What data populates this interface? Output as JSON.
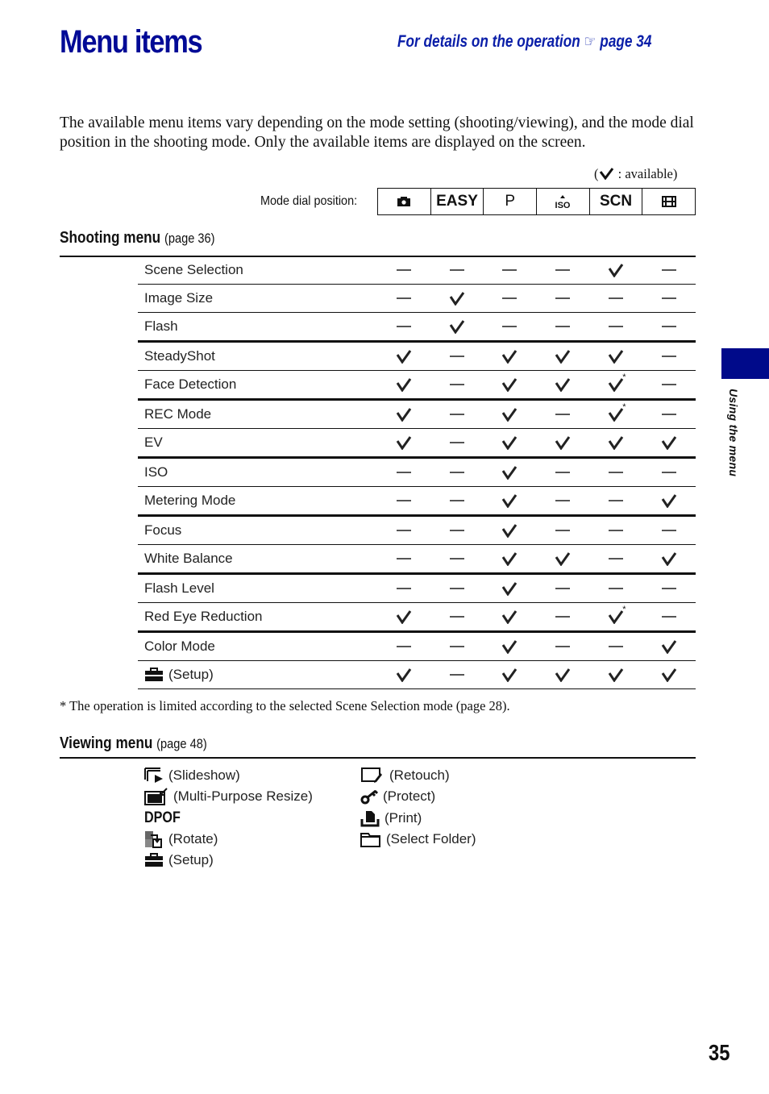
{
  "page": {
    "title": "Menu items",
    "xref_prefix": "For details on the operation",
    "xref_page": "page 34",
    "intro": "The available menu items vary depending on the mode setting (shooting/viewing), and the mode dial position in the shooting mode. Only the available items are displayed on the screen.",
    "legend_text": " : available)",
    "legend_open": "(",
    "page_number": "35",
    "side_tab_label": "Using the menu",
    "accent_color": "#000a96"
  },
  "mode_dial": {
    "label": "Mode dial position:",
    "positions": [
      {
        "name": "auto-adjustment",
        "icon": "camera-icon",
        "text": ""
      },
      {
        "name": "easy-shooting",
        "icon": "",
        "text": "EASY"
      },
      {
        "name": "program-auto",
        "icon": "",
        "text": "P"
      },
      {
        "name": "high-sensitivity",
        "icon": "high-iso-icon",
        "text": ""
      },
      {
        "name": "scene-selection",
        "icon": "",
        "text": "SCN"
      },
      {
        "name": "movie",
        "icon": "film-icon",
        "text": ""
      }
    ]
  },
  "shooting_menu": {
    "heading": "Shooting menu",
    "page_ref": "(page 36)",
    "rows": [
      {
        "label": "Scene Selection",
        "values": [
          "-",
          "-",
          "-",
          "-",
          "v",
          "-"
        ]
      },
      {
        "label": "Image Size",
        "values": [
          "-",
          "v",
          "-",
          "-",
          "-",
          "-"
        ]
      },
      {
        "label": "Flash",
        "values": [
          "-",
          "v",
          "-",
          "-",
          "-",
          "-"
        ],
        "thick": true
      },
      {
        "label": "SteadyShot",
        "values": [
          "v",
          "-",
          "v",
          "v",
          "v",
          "-"
        ]
      },
      {
        "label": "Face Detection",
        "values": [
          "v",
          "-",
          "v",
          "v",
          "v*",
          "-"
        ],
        "thick": true
      },
      {
        "label": "REC Mode",
        "values": [
          "v",
          "-",
          "v",
          "-",
          "v*",
          "-"
        ]
      },
      {
        "label": "EV",
        "values": [
          "v",
          "-",
          "v",
          "v",
          "v",
          "v"
        ],
        "thick": true
      },
      {
        "label": "ISO",
        "values": [
          "-",
          "-",
          "v",
          "-",
          "-",
          "-"
        ]
      },
      {
        "label": "Metering Mode",
        "values": [
          "-",
          "-",
          "v",
          "-",
          "-",
          "v"
        ],
        "thick": true
      },
      {
        "label": "Focus",
        "values": [
          "-",
          "-",
          "v",
          "-",
          "-",
          "-"
        ]
      },
      {
        "label": "White Balance",
        "values": [
          "-",
          "-",
          "v",
          "v",
          "-",
          "v"
        ],
        "thick": true
      },
      {
        "label": "Flash Level",
        "values": [
          "-",
          "-",
          "v",
          "-",
          "-",
          "-"
        ]
      },
      {
        "label": "Red Eye Reduction",
        "values": [
          "v",
          "-",
          "v",
          "-",
          "v*",
          "-"
        ],
        "thick": true
      },
      {
        "label": "Color Mode",
        "values": [
          "-",
          "-",
          "v",
          "-",
          "-",
          "v"
        ]
      },
      {
        "label": "(Setup)",
        "icon": "toolbox-icon",
        "values": [
          "v",
          "-",
          "v",
          "v",
          "v",
          "v"
        ]
      }
    ],
    "footnote": "* The operation is limited according to the selected Scene Selection mode (page 28)."
  },
  "viewing_menu": {
    "heading": "Viewing menu",
    "page_ref": "(page 48)",
    "left_items": [
      {
        "label": "(Slideshow)",
        "icon": "slideshow-icon"
      },
      {
        "label": "(Multi-Purpose Resize)",
        "icon": "resize-icon"
      },
      {
        "label": "DPOF",
        "icon": "dpof"
      },
      {
        "label": "(Rotate)",
        "icon": "rotate-icon"
      },
      {
        "label": "(Setup)",
        "icon": "toolbox-icon"
      }
    ],
    "right_items": [
      {
        "label": "(Retouch)",
        "icon": "retouch-icon"
      },
      {
        "label": "(Protect)",
        "icon": "key-icon"
      },
      {
        "label": "(Print)",
        "icon": "print-icon"
      },
      {
        "label": "(Select Folder)",
        "icon": "folder-icon"
      }
    ]
  }
}
